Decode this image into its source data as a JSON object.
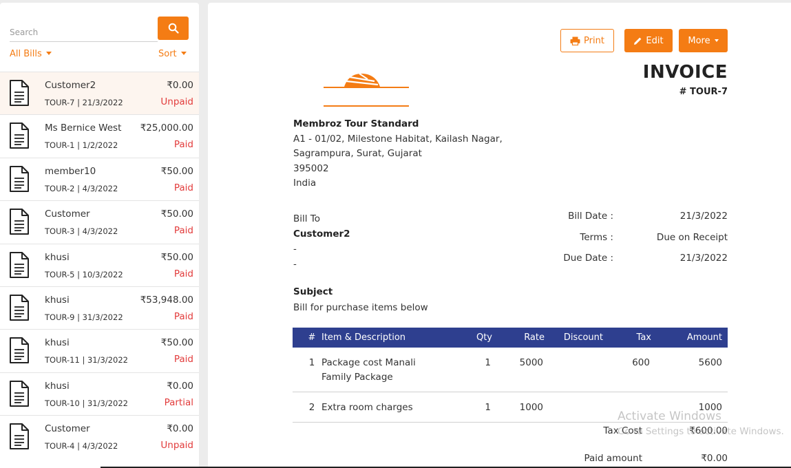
{
  "search": {
    "placeholder": "Search"
  },
  "filters": {
    "all_bills": "All Bills",
    "sort": "Sort"
  },
  "bills": [
    {
      "name": "Customer2",
      "number": "TOUR-7",
      "date": "21/3/2022",
      "amount": "₹0.00",
      "status": "Unpaid"
    },
    {
      "name": "Ms Bernice West",
      "number": "TOUR-1",
      "date": "1/2/2022",
      "amount": "₹25,000.00",
      "status": "Paid"
    },
    {
      "name": "member10",
      "number": "TOUR-2",
      "date": "4/3/2022",
      "amount": "₹50.00",
      "status": "Paid"
    },
    {
      "name": "Customer",
      "number": "TOUR-3",
      "date": "4/3/2022",
      "amount": "₹50.00",
      "status": "Paid"
    },
    {
      "name": "khusi",
      "number": "TOUR-5",
      "date": "10/3/2022",
      "amount": "₹50.00",
      "status": "Paid"
    },
    {
      "name": "khusi",
      "number": "TOUR-9",
      "date": "31/3/2022",
      "amount": "₹53,948.00",
      "status": "Paid"
    },
    {
      "name": "khusi",
      "number": "TOUR-11",
      "date": "31/3/2022",
      "amount": "₹50.00",
      "status": "Paid"
    },
    {
      "name": "khusi",
      "number": "TOUR-10",
      "date": "31/3/2022",
      "amount": "₹0.00",
      "status": "Partial"
    },
    {
      "name": "Customer",
      "number": "TOUR-4",
      "date": "4/3/2022",
      "amount": "₹0.00",
      "status": "Unpaid"
    }
  ],
  "toolbar": {
    "print": "Print",
    "edit": "Edit",
    "more": "More"
  },
  "invoice": {
    "title": "INVOICE",
    "number": "# TOUR-7",
    "org": {
      "name": "Membroz Tour Standard",
      "address1": "A1 - 01/02, Milestone Habitat, Kailash Nagar,",
      "address2": "Sagrampura, Surat, Gujarat",
      "zip": "395002",
      "country": "India"
    },
    "bill_to": {
      "label": "Bill To",
      "customer": "Customer2",
      "line1": "-",
      "line2": "-"
    },
    "bill_date": {
      "label": "Bill Date :",
      "value": "21/3/2022"
    },
    "terms": {
      "label": "Terms :",
      "value": "Due on Receipt"
    },
    "due_date": {
      "label": "Due Date :",
      "value": "21/3/2022"
    },
    "subject": {
      "label": "Subject",
      "text": "Bill for purchase items below"
    },
    "table": {
      "headers": [
        "#",
        "Item & Description",
        "Qty",
        "Rate",
        "Discount",
        "Tax",
        "Amount"
      ],
      "rows": [
        {
          "no": "1",
          "description": "Package cost Manali Family Package",
          "qty": "1",
          "rate": "5000",
          "discount": "",
          "tax": "600",
          "amount": "5600"
        },
        {
          "no": "2",
          "description": "Extra room charges",
          "qty": "1",
          "rate": "1000",
          "discount": "",
          "tax": "",
          "amount": "1000"
        }
      ]
    },
    "totals": {
      "tax_cost": {
        "label": "Tax Cost",
        "value": "₹600.00"
      },
      "paid_amount": {
        "label": "Paid amount",
        "value": "₹0.00"
      }
    }
  },
  "watermark": {
    "line1": "Activate Windows",
    "line2": "Go to Settings to activate Windows."
  },
  "colors": {
    "accent": "#f47c14",
    "table_header": "#2e3f8f",
    "status": "#e23b3b"
  }
}
